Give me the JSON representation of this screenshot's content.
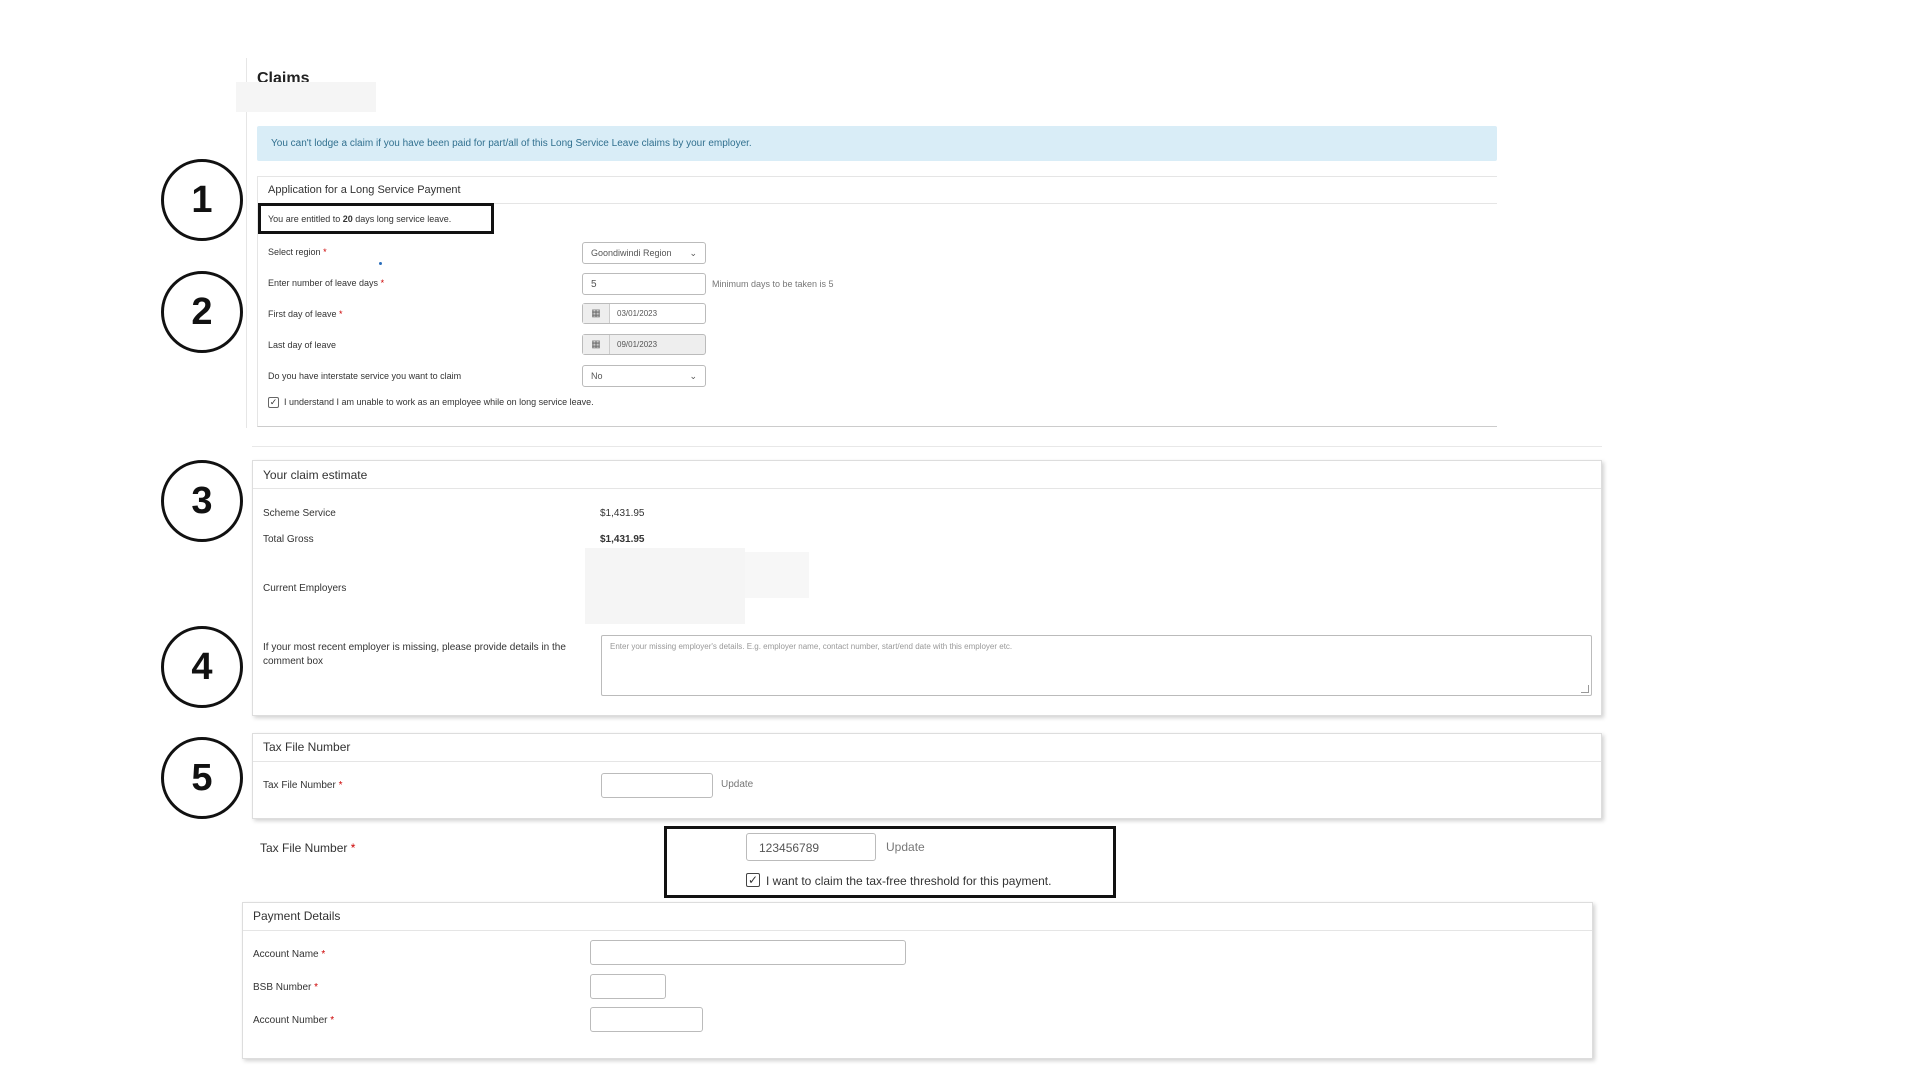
{
  "page": {
    "title": "Claims"
  },
  "alert": {
    "text": "You can't lodge a claim if you have been paid for part/all of this Long Service Leave claims by your employer."
  },
  "application": {
    "title": "Application for a Long Service Payment",
    "entitlement_prefix": "You are entitled to ",
    "entitlement_days": "20",
    "entitlement_suffix": " days long service leave.",
    "fields": {
      "region": {
        "label": "Select region",
        "value": "Goondiwindi Region"
      },
      "leave_days": {
        "label": "Enter number of leave days",
        "value": "5",
        "hint": "Minimum days to be taken is 5"
      },
      "first_day": {
        "label": "First day of leave",
        "value": "03/01/2023"
      },
      "last_day": {
        "label": "Last day of leave",
        "value": "09/01/2023"
      },
      "interstate": {
        "label": "Do you have interstate service you want to claim",
        "value": "No"
      }
    },
    "checkbox_label": "I understand I am unable to work as an employee while on long service leave.",
    "checkbox_checked": true
  },
  "estimate": {
    "title": "Your claim estimate",
    "scheme_service_label": "Scheme Service",
    "scheme_service_value": "$1,431.95",
    "total_gross_label": "Total Gross",
    "total_gross_value": "$1,431.95",
    "current_employers_label": "Current Employers",
    "missing_employer_label": "If your most recent employer is missing, please provide details in the comment box",
    "comment_placeholder": "Enter your missing employer's details. E.g. employer name, contact number, start/end date with this employer etc."
  },
  "tfn": {
    "title": "Tax File Number",
    "label": "Tax File Number",
    "value": "",
    "update_label": "Update"
  },
  "tfn_example": {
    "label": "Tax File Number",
    "value": "123456789",
    "update_label": "Update",
    "threshold_label": "I want to claim the tax-free threshold for this payment.",
    "threshold_checked": true
  },
  "payment": {
    "title": "Payment Details",
    "account_name_label": "Account Name",
    "bsb_label": "BSB Number",
    "account_number_label": "Account Number"
  },
  "annotations": [
    "1",
    "2",
    "3",
    "4",
    "5"
  ],
  "required_marker": "*",
  "icons": {
    "calendar": "calendar-icon",
    "chevron": "chevron-down-icon",
    "check": "checkmark-icon"
  },
  "colors": {
    "alert_bg": "#d9edf7",
    "alert_text": "#31708f",
    "required": "#cc0000"
  }
}
